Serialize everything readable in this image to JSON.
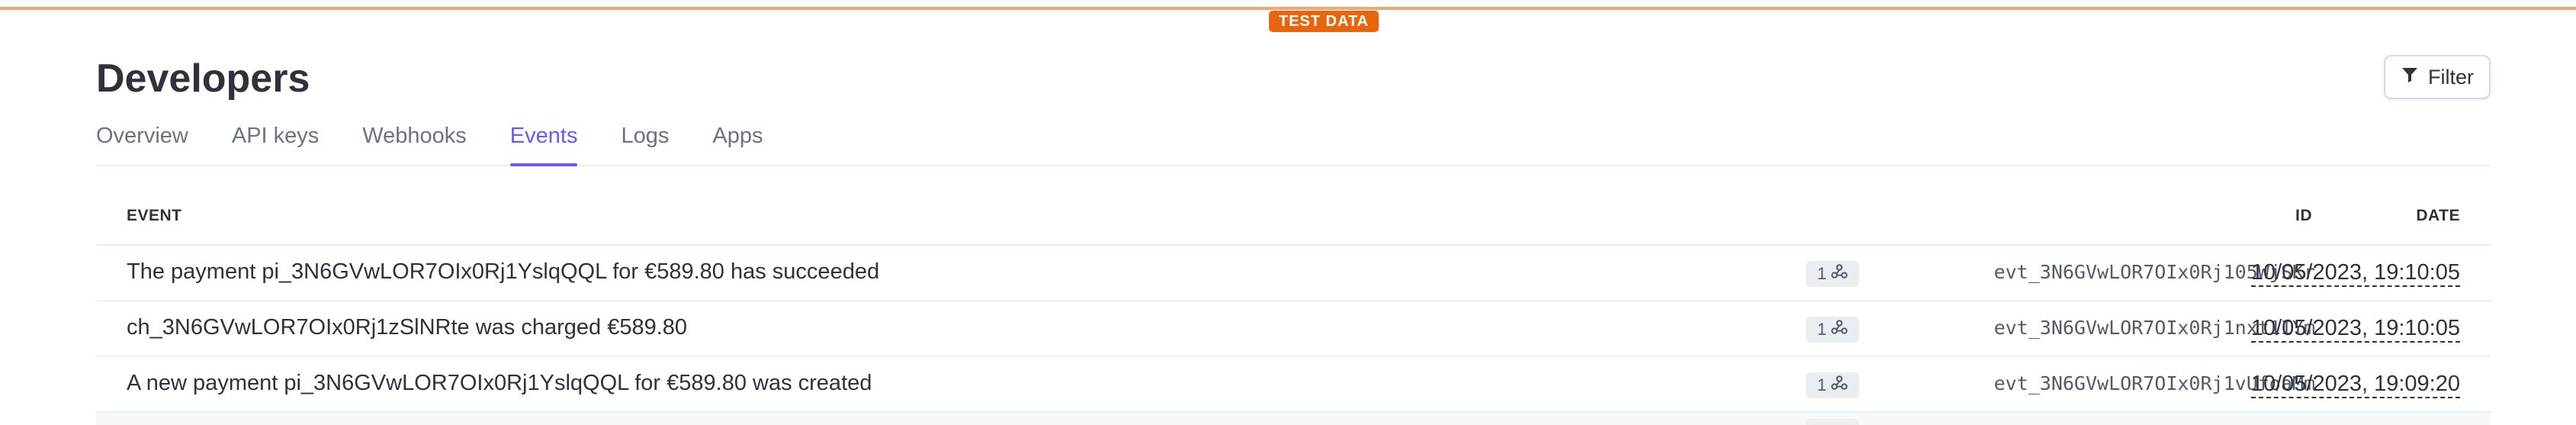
{
  "banner": {
    "label": "TEST DATA"
  },
  "page": {
    "title": "Developers"
  },
  "toolbar": {
    "filter_label": "Filter",
    "filter_icon": "funnel-icon"
  },
  "tabs": [
    {
      "label": "Overview",
      "active": false
    },
    {
      "label": "API keys",
      "active": false
    },
    {
      "label": "Webhooks",
      "active": false
    },
    {
      "label": "Events",
      "active": true
    },
    {
      "label": "Logs",
      "active": false
    },
    {
      "label": "Apps",
      "active": false
    }
  ],
  "table": {
    "columns": {
      "event": "EVENT",
      "id": "ID",
      "date": "DATE"
    },
    "rows": [
      {
        "description": "The payment pi_3N6GVwLOR7OIx0Rj1YslqQQL for €589.80 has succeeded",
        "webhook_count": "1",
        "id": "evt_3N6GVwLOR7OIx0Rj105WjSKr",
        "date": "10/05/2023, 19:10:05"
      },
      {
        "description": "ch_3N6GVwLOR7OIx0Rj1zSlNRte was charged €589.80",
        "webhook_count": "1",
        "id": "evt_3N6GVwLOR7OIx0Rj1nxt1IYm",
        "date": "10/05/2023, 19:10:05"
      },
      {
        "description": "A new payment pi_3N6GVwLOR7OIx0Rj1YslqQQL for €589.80 was created",
        "webhook_count": "1",
        "id": "evt_3N6GVwLOR7OIx0Rj1vUfoaMm",
        "date": "10/05/2023, 19:09:20"
      }
    ]
  },
  "colors": {
    "accent": "#635bff",
    "test_banner": "#e8650e",
    "border": "#ebeef1",
    "text": "#30313d",
    "muted": "#687385"
  }
}
